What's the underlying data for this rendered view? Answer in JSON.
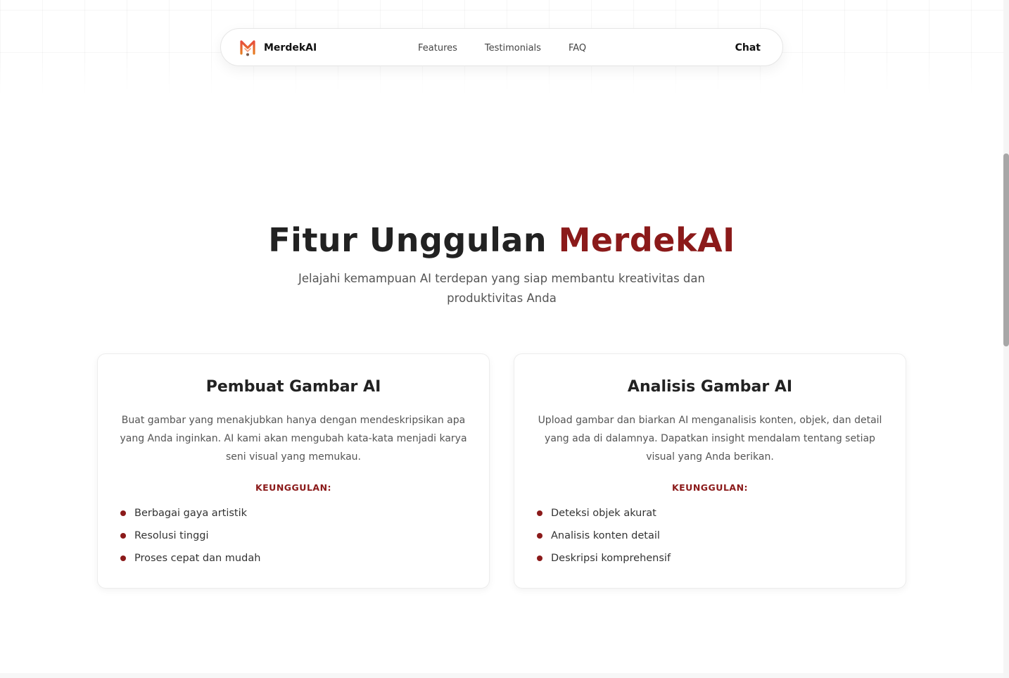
{
  "navbar": {
    "brand_name": "MerdekAI",
    "links": [
      "Features",
      "Testimonials",
      "FAQ"
    ],
    "chat_label": "Chat",
    "logo_icon": "merdekai-m-logo-icon",
    "logo_colors": [
      "#c0392b",
      "#e67e22"
    ]
  },
  "hero": {
    "title_main": "Fitur Unggulan",
    "title_accent": "MerdekAI",
    "subtitle": "Jelajahi kemampuan AI terdepan yang siap membantu kreativitas dan produktivitas Anda"
  },
  "cards": [
    {
      "title": "Pembuat Gambar AI",
      "description": "Buat gambar yang menakjubkan hanya dengan mendeskripsikan apa yang Anda inginkan. AI kami akan mengubah kata-kata menjadi karya seni visual yang memukau.",
      "advantages_label": "KEUNGGULAN:",
      "advantages": [
        "Berbagai gaya artistik",
        "Resolusi tinggi",
        "Proses cepat dan mudah"
      ]
    },
    {
      "title": "Analisis Gambar AI",
      "description": "Upload gambar dan biarkan AI menganalisis konten, objek, dan detail yang ada di dalamnya. Dapatkan insight mendalam tentang setiap visual yang Anda berikan.",
      "advantages_label": "KEUNGGULAN:",
      "advantages": [
        "Deteksi objek akurat",
        "Analisis konten detail",
        "Deskripsi komprehensif"
      ]
    }
  ],
  "colors": {
    "accent": "#8b1a1a",
    "text_dark": "#222222",
    "text_muted": "#555555"
  }
}
